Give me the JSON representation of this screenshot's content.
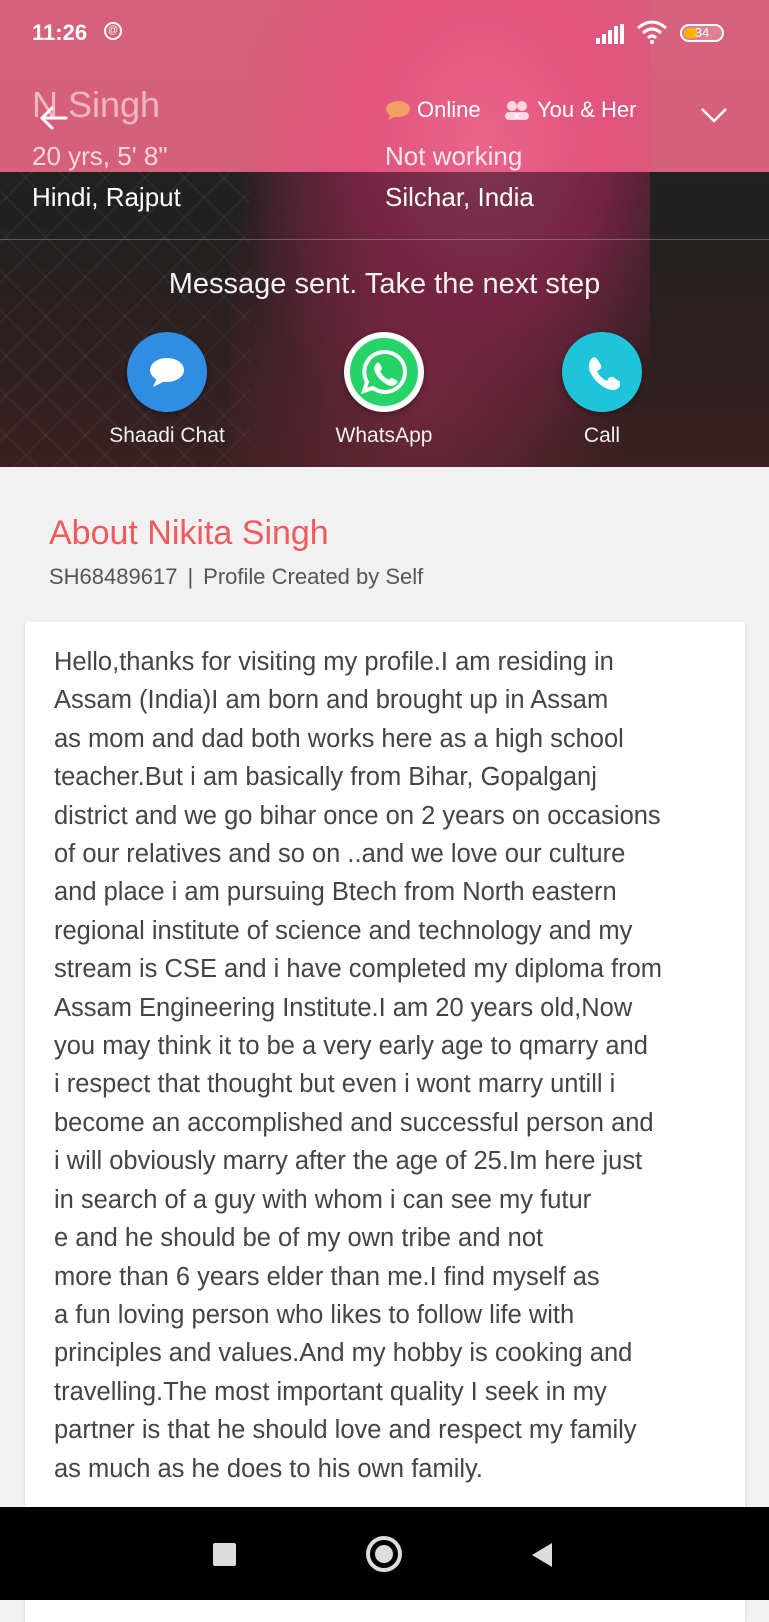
{
  "status_bar": {
    "time": "11:26",
    "battery": "34"
  },
  "profile": {
    "name": "N Singh",
    "online_label": "Online",
    "you_her_label": "You & Her",
    "age_height": "20 yrs, 5' 8\"",
    "work": "Not working",
    "language_caste": "Hindi, Rajput",
    "location": "Silchar, India"
  },
  "message": "Message sent. Take the next step",
  "actions": [
    {
      "label": "Shaadi Chat",
      "icon": "chat-bubble-icon",
      "color": "#2f8de4"
    },
    {
      "label": "WhatsApp",
      "icon": "whatsapp-icon",
      "color": "#25d366"
    },
    {
      "label": "Call",
      "icon": "phone-icon",
      "color": "#1ec5da"
    }
  ],
  "about": {
    "title": "About Nikita Singh",
    "profile_id": "SH68489617",
    "separator": "|",
    "created_by": "Profile Created by Self",
    "bio": "Hello,thanks for visiting my profile.I am residing in\nAssam (India)I am born and brought up in Assam\nas mom and dad both works here as a high school\nteacher.But i am basically from Bihar, Gopalganj\ndistrict and we go bihar once on 2 years on occasions\nof our relatives and so on ..and we love our culture\nand place i am pursuing Btech from North eastern\nregional institute of science and technology and my\nstream is CSE and i have completed my diploma from\nAssam Engineering Institute.I am 20 years old,Now\nyou may think it to be a very early age to qmarry and\ni respect that thought but even i wont marry untill i\nbecome an accomplished and successful person and\ni will obviously marry after the age of 25.Im here just\nin search of a guy with whom i can see my futur\ne and he should be of my own tribe  and not\nmore than 6 years elder than me.I find myself as\na fun loving person who likes to follow life with\nprinciples and values.And my hobby is cooking and\ntravelling.The most important quality I seek in my\npartner is that he should love and respect my family\nas much as he does to his own family."
  },
  "colors": {
    "accent": "#ef5a5f"
  }
}
